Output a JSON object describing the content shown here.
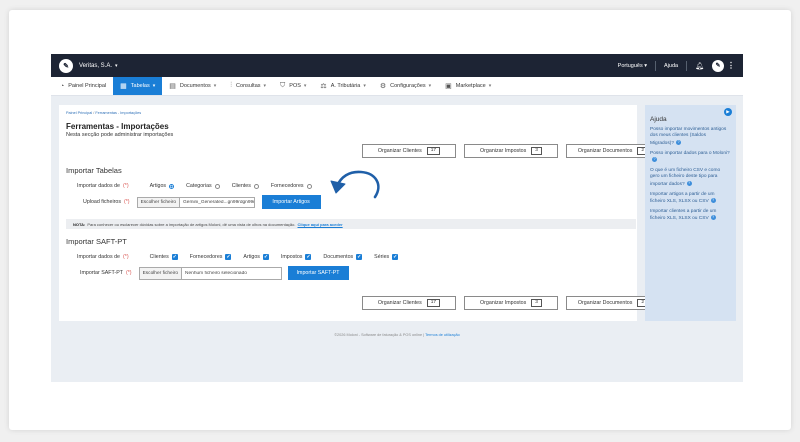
{
  "topbar": {
    "company": "Veritas, S.A.",
    "language": "Português",
    "help": "Ajuda",
    "bell_icon": "bell-icon",
    "user_icon": "user-avatar",
    "menu_icon": "kebab-icon"
  },
  "nav": {
    "items": [
      {
        "label": "Painel Principal",
        "icon": "dashboard-icon",
        "caret": false
      },
      {
        "label": "Tabelas",
        "icon": "table-icon",
        "caret": true,
        "active": true
      },
      {
        "label": "Documentos",
        "icon": "document-icon",
        "caret": true
      },
      {
        "label": "Consultas",
        "icon": "chart-icon",
        "caret": true
      },
      {
        "label": "POS",
        "icon": "pos-icon",
        "caret": true
      },
      {
        "label": "A. Tributária",
        "icon": "tax-icon",
        "caret": true
      },
      {
        "label": "Configurações",
        "icon": "settings-icon",
        "caret": true
      },
      {
        "label": "Marketplace",
        "icon": "marketplace-icon",
        "caret": true
      }
    ]
  },
  "breadcrumb": {
    "home": "Painel Principal",
    "separator": "/",
    "current": "Ferramentas - Importações"
  },
  "page": {
    "title": "Ferramentas - Importações",
    "subtitle": "Nesta secção pode administrar importações"
  },
  "organize": {
    "clients_label": "Organizar Clientes",
    "clients_count": "17",
    "taxes_label": "Organizar Impostos",
    "taxes_count": "3",
    "documents_label": "Organizar Documentos",
    "documents_count": "2"
  },
  "import_tables": {
    "title": "Importar Tabelas",
    "data_label": "Importar dados de",
    "required": "(*)",
    "options": [
      {
        "label": "Artigos",
        "selected": true
      },
      {
        "label": "Categorias",
        "selected": false
      },
      {
        "label": "Clientes",
        "selected": false
      },
      {
        "label": "Fornecedores",
        "selected": false
      }
    ],
    "upload_label": "Upload ficheiros",
    "choose_button": "Escolher ficheiro",
    "file_name": "Gemini_Generated...gn99rdgn99rdg.png",
    "submit_button": "Importar Artigos",
    "note_label": "NOTA:",
    "note_text": "Para conhecer ou esclarecer dúvidas sobre a importação de artigos Moloni, dê uma vista de olhos na documentação.",
    "note_link": "Clique aqui para aceder"
  },
  "import_saft": {
    "title": "Importar SAFT-PT",
    "data_label": "Importar dados de",
    "required": "(*)",
    "options": [
      {
        "label": "Clientes",
        "checked": true
      },
      {
        "label": "Fornecedores",
        "checked": true
      },
      {
        "label": "Artigos",
        "checked": true
      },
      {
        "label": "Impostos",
        "checked": true
      },
      {
        "label": "Documentos",
        "checked": true
      },
      {
        "label": "Séries",
        "checked": true
      }
    ],
    "file_label": "Importar SAFT-PT",
    "choose_button": "Escolher ficheiro",
    "file_name": "Nenhum ficheiro selecionado",
    "submit_button": "Importar SAFT-PT"
  },
  "help_panel": {
    "title": "Ajuda",
    "items": [
      "Posso importar movimentos antigos dos meus clientes (Saldos Migrados)?",
      "Posso importar dados para o Moloni?",
      "O que é um ficheiro CSV e como gero um ficheiro deste tipo para importar dados?",
      "Importar artigos a partir de um ficheiro XLS, XLSX ou CSV",
      "Importar clientes a partir de um ficheiro XLS, XLSX ou CSV"
    ]
  },
  "footer": {
    "text": "©2026 Moloni - Software de faturação & POS online",
    "separator": "|",
    "link": "Termos de utilização"
  },
  "colors": {
    "accent": "#1a7ed6",
    "topbar": "#1d2434",
    "panel": "#d5e2f2",
    "required": "#d9534f"
  }
}
